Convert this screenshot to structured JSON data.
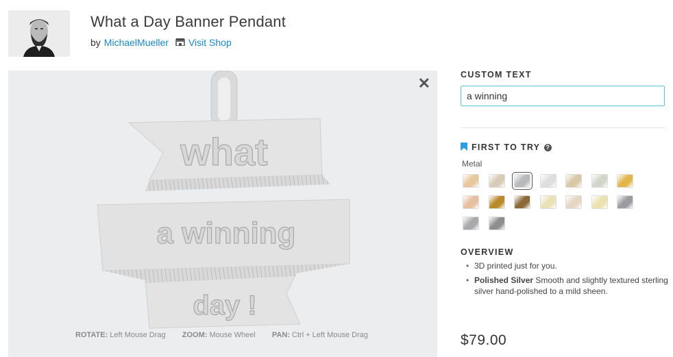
{
  "product": {
    "title": "What a Day Banner Pendant",
    "by_label": "by",
    "designer": "MichaelMueller",
    "shop_link": "Visit Shop"
  },
  "viewer": {
    "close_glyph": "✕",
    "banner_lines": [
      "what",
      "a winning",
      "day !"
    ],
    "controls": [
      {
        "key": "ROTATE:",
        "value": "Left Mouse Drag"
      },
      {
        "key": "ZOOM:",
        "value": "Mouse Wheel"
      },
      {
        "key": "PAN:",
        "value": "Ctrl + Left Mouse Drag"
      }
    ]
  },
  "custom_text": {
    "label": "CUSTOM TEXT",
    "value": "a winning"
  },
  "first_to_try": {
    "label": "FIRST TO TRY",
    "help_glyph": "?",
    "metal_label": "Metal",
    "accent": "#2d9ee0",
    "swatches": [
      {
        "name": "metal-swatch-1",
        "color": "#e8c79c",
        "selected": false
      },
      {
        "name": "metal-swatch-2",
        "color": "#d8cbb8",
        "selected": false
      },
      {
        "name": "metal-swatch-3",
        "color": "#b8b9bb",
        "selected": true
      },
      {
        "name": "metal-swatch-4",
        "color": "#dedede",
        "selected": false
      },
      {
        "name": "metal-swatch-5",
        "color": "#d9c8a6",
        "selected": false
      },
      {
        "name": "metal-swatch-6",
        "color": "#d2d6ca",
        "selected": false
      },
      {
        "name": "metal-swatch-7",
        "color": "#e2b64a",
        "selected": false
      },
      {
        "name": "metal-swatch-8",
        "color": "#e6bfa0",
        "selected": false
      },
      {
        "name": "metal-swatch-9",
        "color": "#b88a2a",
        "selected": false
      },
      {
        "name": "metal-swatch-10",
        "color": "#8d6a3a",
        "selected": false
      },
      {
        "name": "metal-swatch-11",
        "color": "#e7e2b8",
        "selected": false
      },
      {
        "name": "metal-swatch-12",
        "color": "#e6d6c4",
        "selected": false
      },
      {
        "name": "metal-swatch-13",
        "color": "#ece2b0",
        "selected": false
      },
      {
        "name": "metal-swatch-14",
        "color": "#9c9c9e",
        "selected": false
      },
      {
        "name": "metal-swatch-15",
        "color": "#a9a9ab",
        "selected": false
      },
      {
        "name": "metal-swatch-16",
        "color": "#8e8e90",
        "selected": false
      }
    ]
  },
  "overview": {
    "label": "OVERVIEW",
    "item1": "3D printed just for you.",
    "item2_bold": "Polished Silver",
    "item2_text": " Smooth and slightly textured sterling silver hand-polished to a mild sheen."
  },
  "price": "$79.00"
}
